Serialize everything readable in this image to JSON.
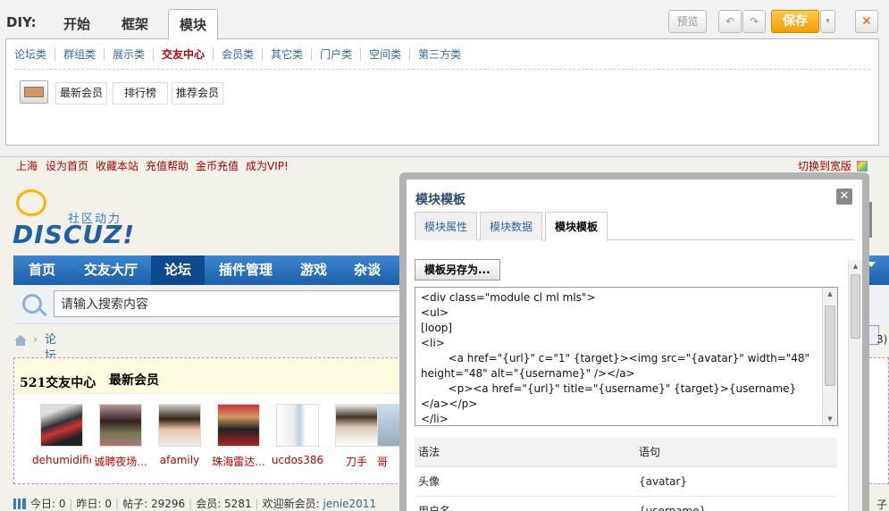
{
  "diy": {
    "label": "DIY:",
    "tabs": [
      "开始",
      "框架",
      "模块"
    ],
    "categories": [
      "论坛类",
      "群组类",
      "展示类",
      "交友中心",
      "会员类",
      "其它类",
      "门户类",
      "空间类",
      "第三方类"
    ],
    "modules": [
      "最新会员",
      "排行榜",
      "推荐会员"
    ],
    "preview_label": "预览",
    "undo_icon": "↶",
    "redo_icon": "↷",
    "save_label": "保存",
    "dropdown_icon": "▾",
    "close_icon": "✕"
  },
  "topbar": {
    "links": [
      "上海",
      "设为首页",
      "收藏本站",
      "充值帮助",
      "金币充值",
      "成为VIP!"
    ],
    "wide_switch": "切换到宽版"
  },
  "logo": {
    "text": "DISCUZ!",
    "sub": "社区动力"
  },
  "nav": {
    "items": [
      "首页",
      "交友大厅",
      "论坛",
      "插件管理",
      "游戏",
      "杂谈"
    ]
  },
  "search": {
    "value": "请输入搜索内容"
  },
  "breadcrumb": {
    "sep": "›",
    "link": "论坛"
  },
  "block": {
    "title": "521交友中心",
    "subtitle": "最新会员",
    "members": [
      "dehumidifier",
      "诚聘夜场...",
      "afamily",
      "珠海雷达...",
      "ucdos386",
      "刀手",
      "哥"
    ]
  },
  "stats": {
    "today": "今日: 0",
    "yesterday": "昨日: 0",
    "posts": "帖子: 29296",
    "members": "会员: 5281",
    "newest_label": "欢迎新会员: ",
    "newest": "jenie2011"
  },
  "dialog": {
    "title": "模块模板",
    "close_icon": "✕",
    "tabs": [
      "模块属性",
      "模块数据",
      "模块模板"
    ],
    "saveas_label": "模板另存为...",
    "template_code": "<div class=\"module cl ml mls\">\n<ul>\n[loop]\n<li>\n        <a href=\"{url}\" c=\"1\" {target}><img src=\"{avatar}\" width=\"48\" height=\"48\" alt=\"{username}\" /></a>\n        <p><a href=\"{url}\" title=\"{username}\" {target}>{username}</a></p>\n</li>\n[/loop]",
    "syntax_header": [
      "语法",
      "语句"
    ],
    "syntax_rows": [
      [
        "头像",
        "{avatar}"
      ],
      [
        "用户名",
        "{username}"
      ]
    ]
  },
  "right_frag": {
    "char1": "子",
    "char2": "3)"
  }
}
